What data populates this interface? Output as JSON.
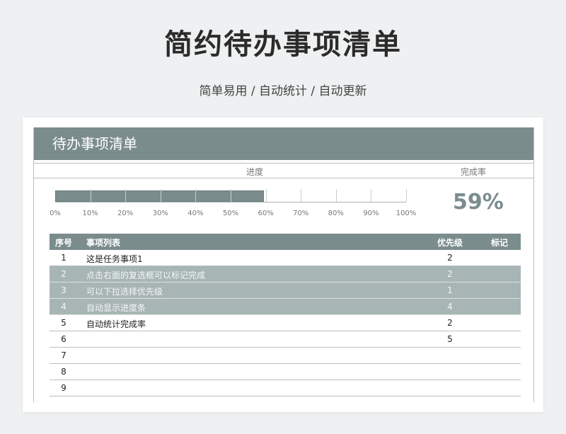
{
  "page": {
    "title": "简约待办事项清单",
    "subtitle": "简单易用 / 自动统计 / 自动更新"
  },
  "sheet": {
    "header": "待办事项清单",
    "progress_label": "进度",
    "rate_label": "完成率",
    "progress_value": 0.59,
    "rate_value": "59%",
    "ticks": [
      "0%",
      "10%",
      "20%",
      "30%",
      "40%",
      "50%",
      "60%",
      "70%",
      "80%",
      "90%",
      "100%"
    ]
  },
  "table": {
    "headers": {
      "no": "序号",
      "item": "事项列表",
      "priority": "优先级",
      "mark": "标记"
    },
    "rows": [
      {
        "no": "1",
        "item": "这是任务事项1",
        "priority": "2",
        "highlight": false
      },
      {
        "no": "2",
        "item": "点击右面的复选框可以标记完成",
        "priority": "2",
        "highlight": true
      },
      {
        "no": "3",
        "item": "可以下拉选择优先级",
        "priority": "1",
        "highlight": true
      },
      {
        "no": "4",
        "item": "自动显示进度条",
        "priority": "4",
        "highlight": true
      },
      {
        "no": "5",
        "item": "自动统计完成率",
        "priority": "2",
        "highlight": false
      },
      {
        "no": "6",
        "item": "",
        "priority": "5",
        "highlight": false
      },
      {
        "no": "7",
        "item": "",
        "priority": "",
        "highlight": false
      },
      {
        "no": "8",
        "item": "",
        "priority": "",
        "highlight": false
      },
      {
        "no": "9",
        "item": "",
        "priority": "",
        "highlight": false
      }
    ]
  },
  "colors": {
    "accent": "#7b8c8d",
    "highlight_row": "#a8b5b5",
    "background": "#eef0f1"
  }
}
